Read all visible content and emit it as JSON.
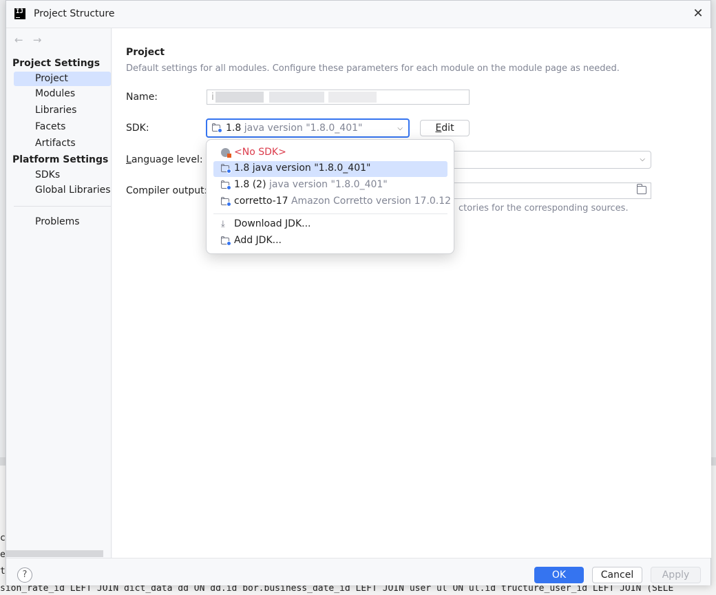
{
  "window": {
    "title": "Project Structure"
  },
  "background_editor": {
    "gutter_chars": [
      "c",
      "e",
      "t"
    ],
    "bottom_line": "sion_rate_id LEFT JOIN dict_data dd ON dd.id   bor.business_date_id LEFT JOIN user ul ON ul.id   tructure_user_id LEFT JOIN (SELE"
  },
  "sidebar": {
    "back_icon": "←",
    "forward_icon": "→",
    "project_settings_header": "Project Settings",
    "project_settings_items": [
      {
        "label": "Project",
        "selected": true
      },
      {
        "label": "Modules"
      },
      {
        "label": "Libraries"
      },
      {
        "label": "Facets"
      },
      {
        "label": "Artifacts"
      }
    ],
    "platform_settings_header": "Platform Settings",
    "platform_settings_items": [
      {
        "label": "SDKs"
      },
      {
        "label": "Global Libraries"
      }
    ],
    "problems_label": "Problems"
  },
  "main": {
    "title": "Project",
    "description": "Default settings for all modules. Configure these parameters for each module on the module page as needed.",
    "name_label": "Name:",
    "name_value_prefix": "i",
    "sdk_label": "SDK:",
    "sdk_selected_name": "1.8",
    "sdk_selected_detail": "java version \"1.8.0_401\"",
    "edit_button_mnemonic": "E",
    "edit_button_rest": "dit",
    "language_level_mnemonic": "L",
    "language_level_rest": "anguage level:",
    "compiler_output_label": "Compiler output:",
    "compiler_output_hint_fragment": "ctories for the corresponding sources."
  },
  "sdk_popup": {
    "items": [
      {
        "name": "<No SDK>",
        "detail": "",
        "icon": "globe-icon",
        "red": true
      },
      {
        "name": "1.8",
        "detail": "java version \"1.8.0_401\"",
        "icon": "jdk-folder-icon",
        "selected": true
      },
      {
        "name": "1.8 (2)",
        "detail": "java version \"1.8.0_401\"",
        "icon": "jdk-folder-icon"
      },
      {
        "name": "corretto-17",
        "detail": "Amazon Corretto version 17.0.12",
        "icon": "jdk-folder-icon"
      }
    ],
    "actions": [
      {
        "label": "Download JDK...",
        "icon": "download-icon"
      },
      {
        "label": "Add JDK...",
        "icon": "jdk-folder-icon"
      }
    ]
  },
  "footer": {
    "help_label": "?",
    "ok_label": "OK",
    "cancel_label": "Cancel",
    "apply_label": "Apply"
  },
  "colors": {
    "accent": "#3574f0",
    "selection": "#d4e2ff",
    "error_red": "#db3b4b",
    "muted_text": "#818594"
  }
}
